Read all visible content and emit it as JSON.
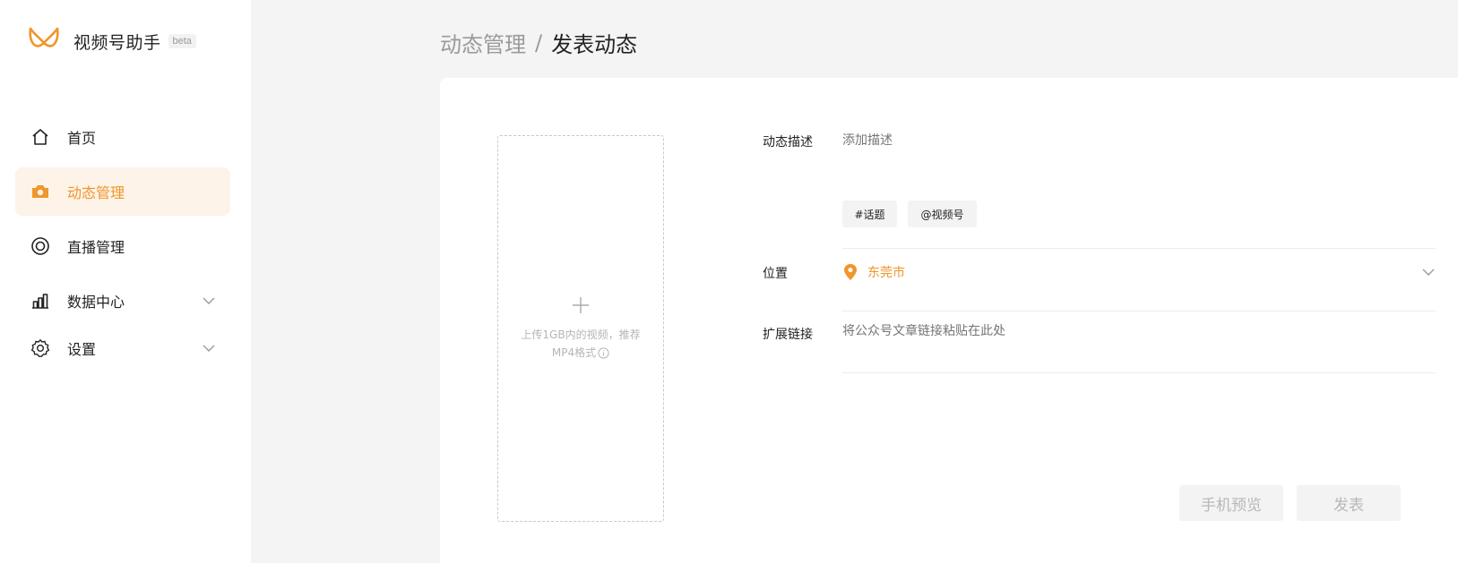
{
  "brand": {
    "name": "视频号助手",
    "badge": "beta",
    "logo_icon": "infinity-logo-icon",
    "accent": "#f0962b"
  },
  "sidebar": {
    "items": [
      {
        "label": "首页",
        "icon": "home-icon",
        "active": false,
        "expandable": false
      },
      {
        "label": "动态管理",
        "icon": "camera-icon",
        "active": true,
        "expandable": false
      },
      {
        "label": "直播管理",
        "icon": "live-ring-icon",
        "active": false,
        "expandable": false
      },
      {
        "label": "数据中心",
        "icon": "bar-chart-icon",
        "active": false,
        "expandable": true
      },
      {
        "label": "设置",
        "icon": "gear-icon",
        "active": false,
        "expandable": true
      }
    ]
  },
  "breadcrumb": {
    "parent": "动态管理",
    "separator": "/",
    "current": "发表动态"
  },
  "upload": {
    "hint_line1": "上传1GB内的视频，推荐",
    "hint_line2": "MP4格式"
  },
  "form": {
    "description": {
      "label": "动态描述",
      "placeholder": "添加描述"
    },
    "tags": {
      "topic": "#话题",
      "mention": "@视频号"
    },
    "location": {
      "label": "位置",
      "value": "东莞市"
    },
    "link": {
      "label": "扩展链接",
      "placeholder": "将公众号文章链接粘贴在此处"
    }
  },
  "actions": {
    "preview": "手机预览",
    "publish": "发表"
  }
}
